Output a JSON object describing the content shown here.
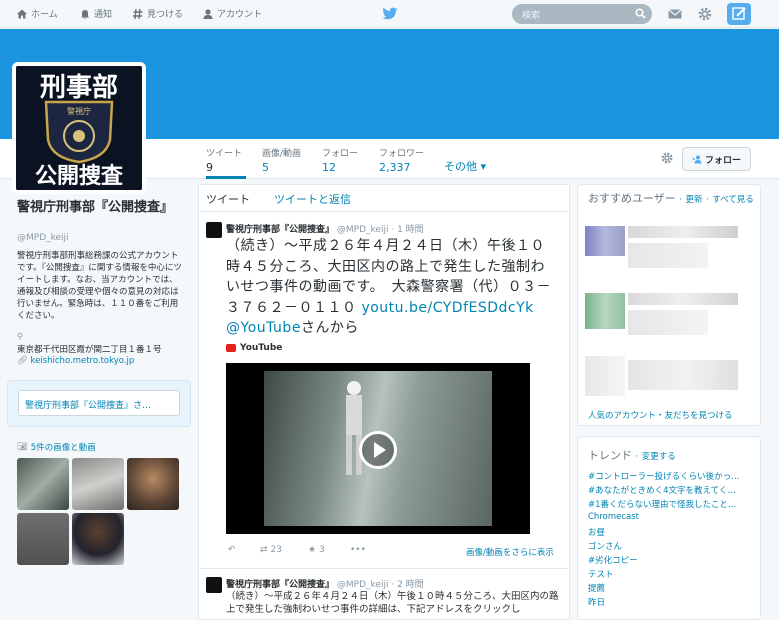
{
  "nav": {
    "home": "ホーム",
    "notifications": "通知",
    "discover": "見つける",
    "account": "アカウント",
    "search_placeholder": "検索"
  },
  "profile": {
    "name": "警視庁刑事部『公開捜査』",
    "handle": "@MPD_keiji",
    "bio": "警視庁刑事部刑事総務課の公式アカウントです。『公開捜査』に関する情報を中心にツイートします。なお、当アカウントでは、通報及び相談の受理や個々の意見の対応は行いません。緊急時は、１１０番をご利用ください。",
    "location": "東京都千代田区霞が関二丁目１番１号",
    "url": "keishicho.metro.tokyo.jp",
    "dm_prompt": "警視庁刑事部『公開捜査』さ…",
    "media_header": "5件の画像と動画",
    "avatar_text": {
      "top": "刑事部",
      "agency": "警視庁",
      "bottom": "公開捜査"
    }
  },
  "stats": [
    {
      "label": "ツイート",
      "value": "9"
    },
    {
      "label": "画像/動画",
      "value": "5"
    },
    {
      "label": "フォロー",
      "value": "12"
    },
    {
      "label": "フォロワー",
      "value": "2,337"
    }
  ],
  "stats_more": "その他",
  "follow_button": "フォロー",
  "timeline": {
    "tab_tweets": "ツイート",
    "tab_replies": "ツイートと返信",
    "tweets": [
      {
        "author": "警視庁刑事部『公開捜査』",
        "handle": "@MPD_keiji",
        "time": "1 時間",
        "text": "（続き）～平成２６年４月２４日（木）午後１０時４５分ころ、大田区内の路上で発生した強制わいせつ事件の動画です。　大森警察署（代）０３－３７６２－０１１０",
        "link": "youtu.be/CYDfESDdcYk",
        "mention": "@YouTube",
        "suffix": "さんから",
        "source": "YouTube",
        "retweets": "23",
        "favorites": "3",
        "more_media": "画像/動画をさらに表示"
      },
      {
        "author": "警視庁刑事部『公開捜査』",
        "handle": "@MPD_keiji",
        "time": "2 時間",
        "text": "（続き）～平成２６年４月２４日（木）午後１０時４５分ころ、大田区内の路上で発生した強制わいせつ事件の詳細は、下記アドレスをクリックし"
      }
    ]
  },
  "who_to_follow": {
    "title": "おすすめユーザー",
    "refresh": "更新",
    "view_all": "すべて見る",
    "footer": "人気のアカウント・友だちを見つける"
  },
  "trends": {
    "title": "トレンド",
    "change": "変更する",
    "items": [
      "#コントローラー投げるくらい後かっ…",
      "#あなたがときめく4文字を教えてく…",
      "#1番くだらない理由で怪我したこと…",
      "Chromecast",
      "お昼",
      "ゴンさん",
      "#劣化コピー",
      "テスト",
      "提薦",
      "昨日"
    ]
  },
  "colors": {
    "accent": "#0084b4",
    "banner": "#1b95e0",
    "brand_blue": "#55acee"
  }
}
